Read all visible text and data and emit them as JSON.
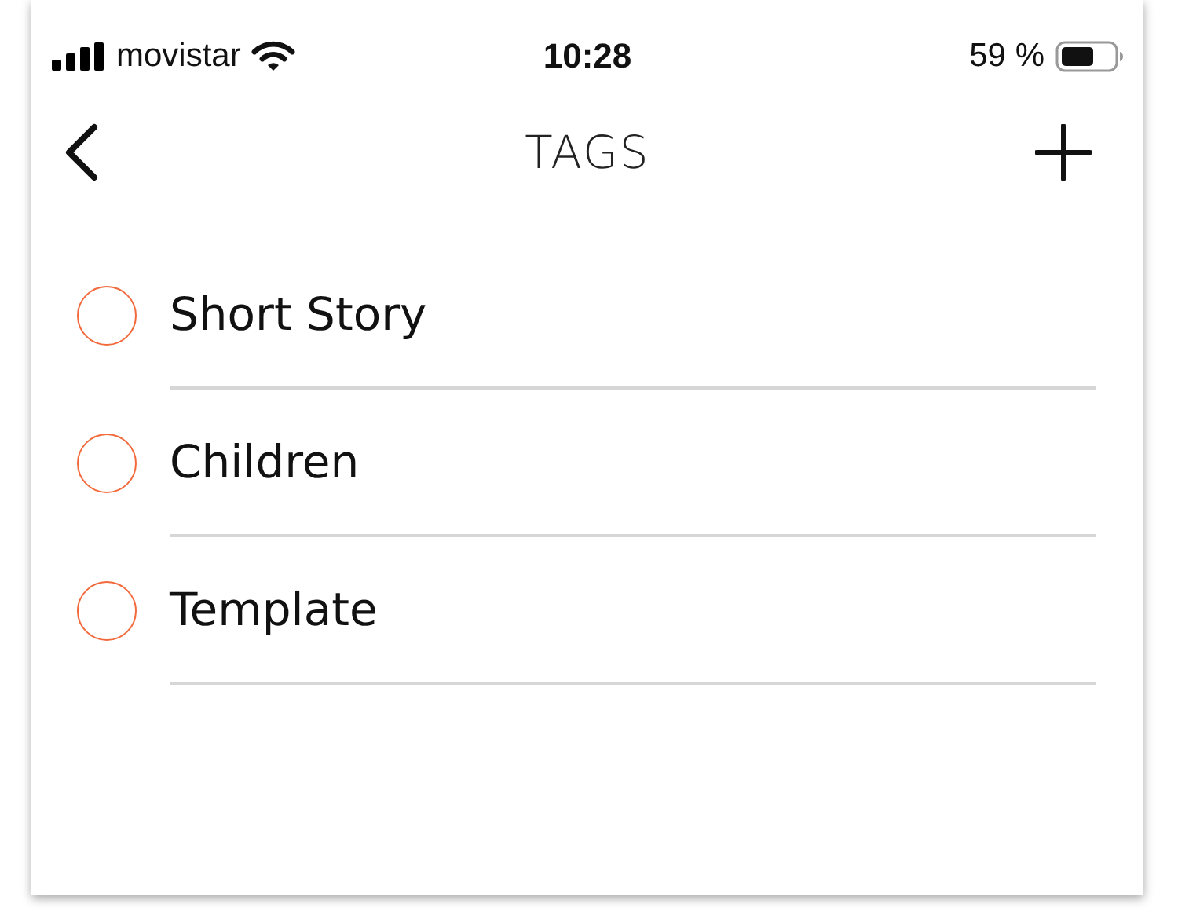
{
  "status_bar": {
    "carrier": "movistar",
    "time": "10:28",
    "battery": "59 %"
  },
  "header": {
    "title": "TAGS"
  },
  "tags": [
    {
      "label": "Short Story",
      "checked": false
    },
    {
      "label": "Children",
      "checked": false
    },
    {
      "label": "Template",
      "checked": false
    }
  ]
}
